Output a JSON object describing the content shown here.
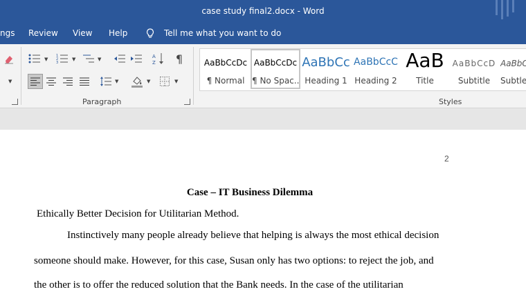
{
  "window": {
    "title": "case study final2.docx  -  Word"
  },
  "menu": {
    "items": [
      "ngs",
      "Review",
      "View",
      "Help",
      "Tell me what you want to do"
    ]
  },
  "ribbon": {
    "paragraph_label": "Paragraph",
    "styles_label": "Styles",
    "styles": [
      {
        "preview": "AaBbCcDc",
        "name": "¶ Normal"
      },
      {
        "preview": "AaBbCcDc",
        "name": "¶ No Spac..."
      },
      {
        "preview": "AaBbCc",
        "name": "Heading 1"
      },
      {
        "preview": "AaBbCcC",
        "name": "Heading 2"
      },
      {
        "preview": "AaB",
        "name": "Title"
      },
      {
        "preview": "AaBbCcD",
        "name": "Subtitle"
      },
      {
        "preview": "AaBbC",
        "name": "Subtle"
      }
    ]
  },
  "document": {
    "page_number": "2",
    "heading": "Case – IT Business Dilemma",
    "subheading": "Ethically Better Decision for Utilitarian Method.",
    "lines": [
      "Instinctively many people already believe that helping is always the most ethical decision",
      "someone should make. However, for this case, Susan only has two options: to reject the job, and",
      "the other is to offer the reduced solution that the Bank needs. In the case of the utilitarian"
    ]
  },
  "colors": {
    "word_blue": "#2b579a",
    "ribbon_bg": "#f3f3f3",
    "heading_blue": "#2e74b5"
  }
}
